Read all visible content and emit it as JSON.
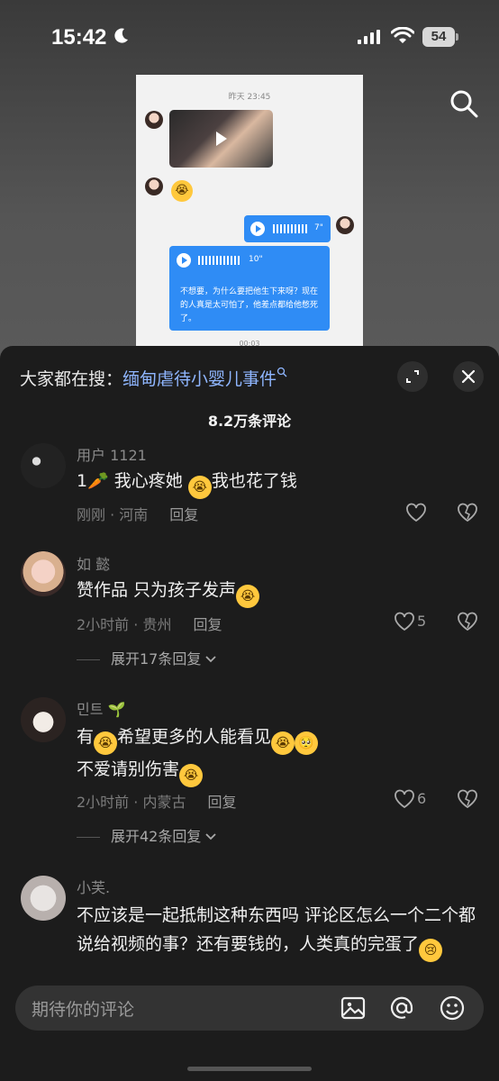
{
  "status": {
    "time": "15:42",
    "battery": "54"
  },
  "video": {
    "chat": {
      "timestamp": "昨天 23:45",
      "voice1_sec": "7\"",
      "voice2_sec": "10\"",
      "message": "不想要，为什么要把他生下来呀？现在的人真是太可怕了，他差点都给他憋死了。",
      "bottom_time": "00:03"
    }
  },
  "sheet": {
    "search_prefix": "大家都在搜：",
    "search_topic": "缅甸虐待小婴儿事件",
    "comment_count": "8.2万条评论"
  },
  "comments": [
    {
      "user": "用户 1121",
      "text_a": "1🥕 我心疼她 ",
      "text_b": "我也花了钱",
      "time_location": "刚刚 · 河南",
      "reply": "回复"
    },
    {
      "user": "如        懿",
      "text_a": "赞作品  只为孩子发声",
      "time_location": "2小时前 · 贵州",
      "reply": "回复",
      "likes": "5",
      "more": "展开17条回复"
    },
    {
      "user": "민트 🌱",
      "text_a": "有",
      "text_b": "希望更多的人能看见",
      "text_c": "不爱请别伤害",
      "time_location": "2小时前 · 内蒙古",
      "reply": "回复",
      "likes": "6",
      "more": "展开42条回复"
    },
    {
      "user": "小芙.",
      "text_a": "不应该是一起抵制这种东西吗 评论区怎么一个二个都说给视频的事？还有要钱的，人类真的完蛋了"
    }
  ],
  "input": {
    "placeholder": "期待你的评论"
  },
  "icons": [
    "moon-icon",
    "signal-icon",
    "wifi-icon",
    "search-icon",
    "expand-icon",
    "close-icon",
    "heart-icon",
    "dislike-icon",
    "chevron-down-icon",
    "image-icon",
    "at-icon",
    "emoji-icon"
  ]
}
